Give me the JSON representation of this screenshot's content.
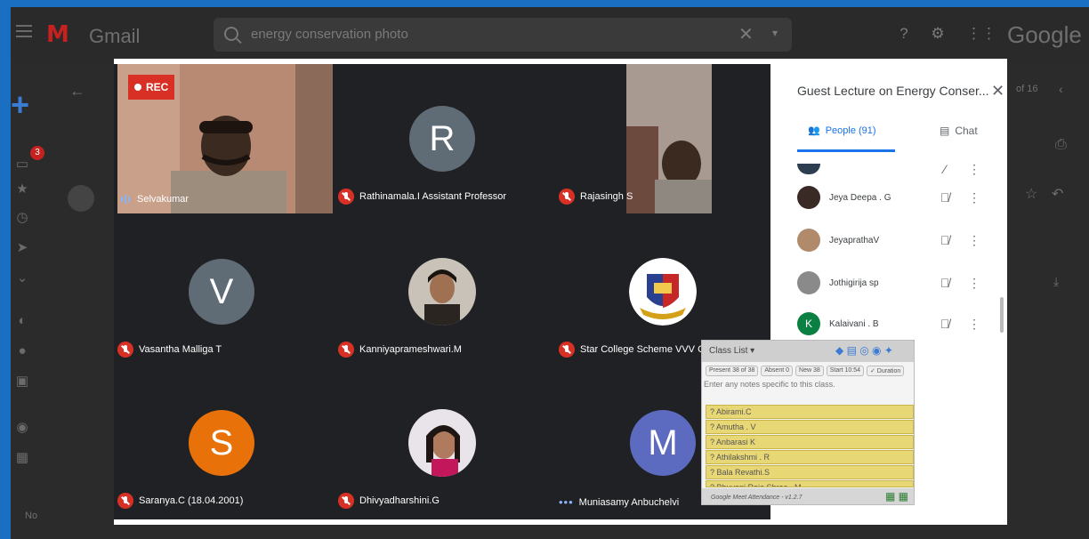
{
  "gmail": {
    "app_name": "Gmail",
    "search_query": "energy conservation photo",
    "brand": "Google",
    "page_count": "of 16",
    "bottom_text": "No",
    "badge_count": "3"
  },
  "meet": {
    "rec_label": "REC",
    "tiles": [
      {
        "name": "Selvakumar",
        "status": "speaking",
        "type": "video"
      },
      {
        "name": "Rathinamala.I Assistant Professor",
        "status": "muted",
        "type": "avatar",
        "initial": "R",
        "color": "#5f6b75"
      },
      {
        "name": "Rajasingh S",
        "status": "muted",
        "type": "video"
      },
      {
        "name": "Vasantha Malliga T",
        "status": "muted",
        "type": "avatar",
        "initial": "V",
        "color": "#5f6b75"
      },
      {
        "name": "Kanniyaprameshwari.M",
        "status": "muted",
        "type": "photo"
      },
      {
        "name": "Star College Scheme VVV College",
        "status": "muted",
        "type": "logo"
      },
      {
        "name": "Saranya.C (18.04.2001)",
        "status": "muted",
        "type": "avatar",
        "initial": "S",
        "color": "#e8710a"
      },
      {
        "name": "Dhivyadharshini.G",
        "status": "muted",
        "type": "photo"
      },
      {
        "name": "Muniasamy Anbuchelvi",
        "status": "speaking-dots",
        "type": "avatar",
        "initial": "M",
        "color": "#5c6bc0"
      }
    ],
    "panel": {
      "title": "Guest Lecture on Energy Conser...",
      "tab_people": "People (91)",
      "tab_chat": "Chat",
      "people": [
        {
          "name": "Jeya Deepa . G",
          "color": "#3a2a25"
        },
        {
          "name": "JeyaprathaV",
          "color": "#b08a6a"
        },
        {
          "name": "Jothigirija sp",
          "color": "#8a8a8a"
        },
        {
          "name": "Kalaivani . B",
          "color": "#0b8043",
          "initial": "K"
        }
      ]
    },
    "attendance": {
      "title": "Class List",
      "stats": [
        "Present 38 of 38",
        "Absent 0",
        "New 38",
        "Start 10:54",
        "✓ Duration"
      ],
      "notes_placeholder": "Enter any notes specific to this class.",
      "rows": [
        "? Abirami.C",
        "? Amutha . V",
        "? Anbarasi K",
        "? Athilakshmi . R",
        "? Bala Revathi.S",
        "? Bhuvani Raja Shree . M"
      ],
      "footer": "Google Meet Attendance - v1.2.7"
    }
  }
}
